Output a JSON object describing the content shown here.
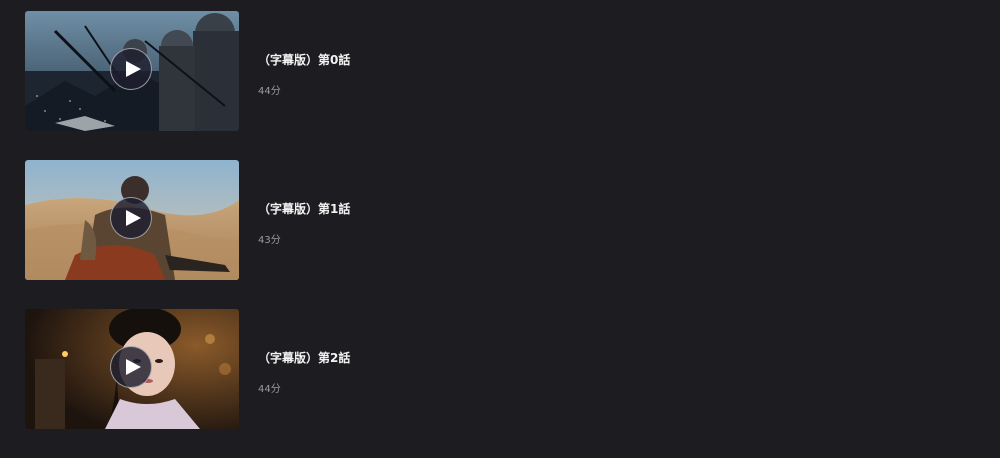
{
  "episodes": [
    {
      "title": "（字幕版）第0話",
      "duration": "44分",
      "thumbnail": "armored-soldiers-battle-scene",
      "play_icon": "play-icon"
    },
    {
      "title": "（字幕版）第1話",
      "duration": "43分",
      "thumbnail": "warrior-in-desert-scene",
      "play_icon": "play-icon"
    },
    {
      "title": "（字幕版）第2話",
      "duration": "44分",
      "thumbnail": "woman-portrait-candlelight-scene",
      "play_icon": "play-icon"
    }
  ],
  "colors": {
    "background": "#1c1c21",
    "title_text": "#f2f2f2",
    "duration_text": "#9a9aa0"
  }
}
